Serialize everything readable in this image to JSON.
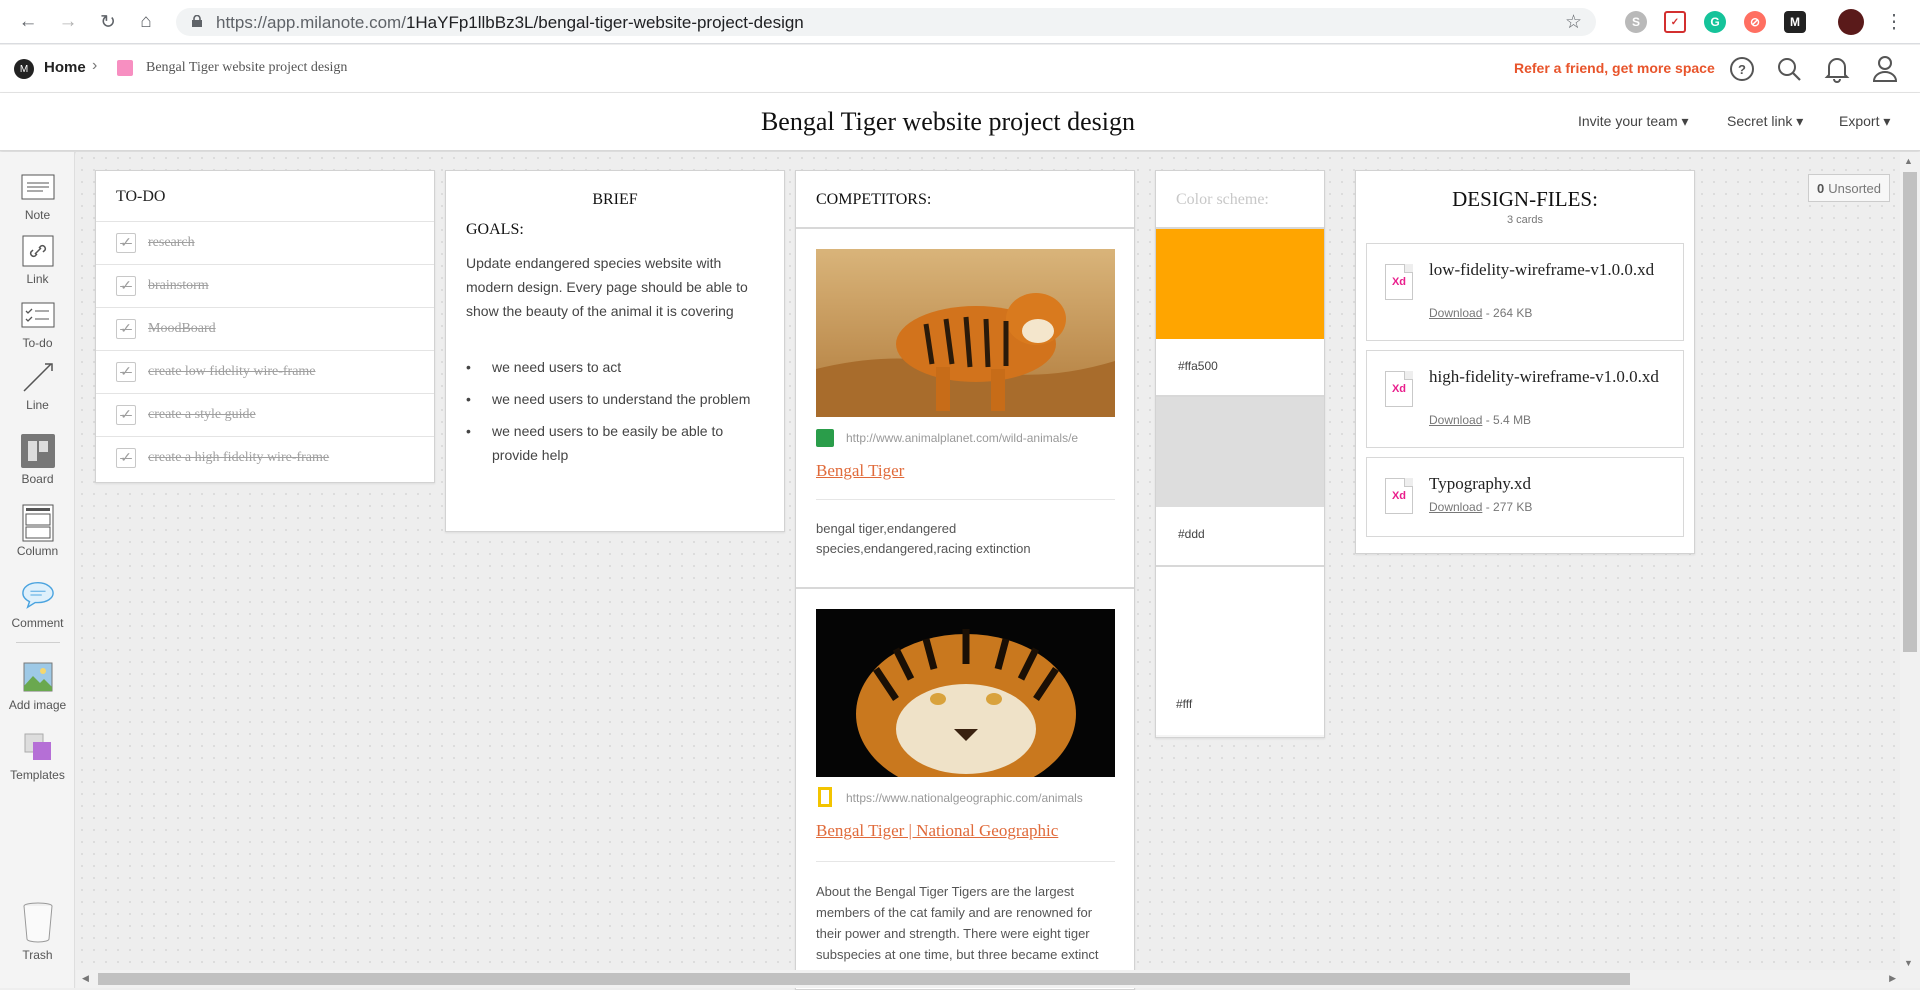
{
  "browser": {
    "url_base": "https://app.milanote.com/",
    "url_path": "1HaYFp1llbBz3L/bengal-tiger-website-project-design"
  },
  "topbar": {
    "home_label": "Home",
    "breadcrumb_board": "Bengal Tiger website project design",
    "referral": "Refer a friend, get more space"
  },
  "header": {
    "title": "Bengal Tiger website project design",
    "invite": "Invite your team",
    "secret_link": "Secret link",
    "export": "Export"
  },
  "sidebar": {
    "items": [
      {
        "label": "Note",
        "icon": "note-icon"
      },
      {
        "label": "Link",
        "icon": "link-icon"
      },
      {
        "label": "To-do",
        "icon": "todo-icon"
      },
      {
        "label": "Line",
        "icon": "line-icon"
      },
      {
        "label": "Board",
        "icon": "board-icon"
      },
      {
        "label": "Column",
        "icon": "column-icon"
      },
      {
        "label": "Comment",
        "icon": "comment-icon"
      },
      {
        "label": "Add image",
        "icon": "image-icon"
      },
      {
        "label": "Templates",
        "icon": "templates-icon"
      },
      {
        "label": "Trash",
        "icon": "trash-icon"
      }
    ]
  },
  "unsorted": {
    "count": "0",
    "label": "Unsorted"
  },
  "todo": {
    "title": "TO-DO",
    "items": [
      "research",
      "brainstorm",
      "MoodBoard",
      "create low fidelity wire-frame",
      "create a style guide",
      "create a high fidelity wire-frame"
    ]
  },
  "brief": {
    "title": "BRIEF",
    "goals_heading": "GOALS:",
    "goals_text": "Update endangered species website with modern design. Every page should be able to show the beauty of the animal it  is covering",
    "bullets": [
      "we need users to act",
      "we need users to understand the problem",
      "we need users to be easily be able to provide help"
    ]
  },
  "competitors": {
    "title": "COMPETITORS:",
    "links": [
      {
        "url": "http://www.animalplanet.com/wild-animals/e",
        "title": "Bengal Tiger",
        "description": "bengal tiger,endangered species,endangered,racing extinction"
      },
      {
        "url": "https://www.nationalgeographic.com/animals",
        "title": "Bengal Tiger | National Geographic",
        "description": "About the Bengal Tiger Tigers are the largest members of the cat family and are renowned for their power and strength. There were eight tiger subspecies at one time, but three became extinct"
      }
    ]
  },
  "colors": {
    "title": "Color scheme:",
    "swatches": [
      {
        "label": "#ffa500",
        "color": "#ffa500"
      },
      {
        "label": "#ddd",
        "color": "#dddddd"
      },
      {
        "label": "#fff",
        "color": "#ffffff"
      }
    ]
  },
  "design_files": {
    "title": "DESIGN-FILES:",
    "count": "3 cards",
    "files": [
      {
        "name": "low-fidelity-wireframe-v1.0.0.xd",
        "download": "Download",
        "size": "- 264 KB"
      },
      {
        "name": "high-fidelity-wireframe-v1.0.0.xd",
        "download": "Download",
        "size": "- 5.4 MB"
      },
      {
        "name": "Typography.xd",
        "download": "Download",
        "size": "- 277 KB"
      }
    ]
  },
  "accent": "#e8542b",
  "board_color": "#f78fc1"
}
